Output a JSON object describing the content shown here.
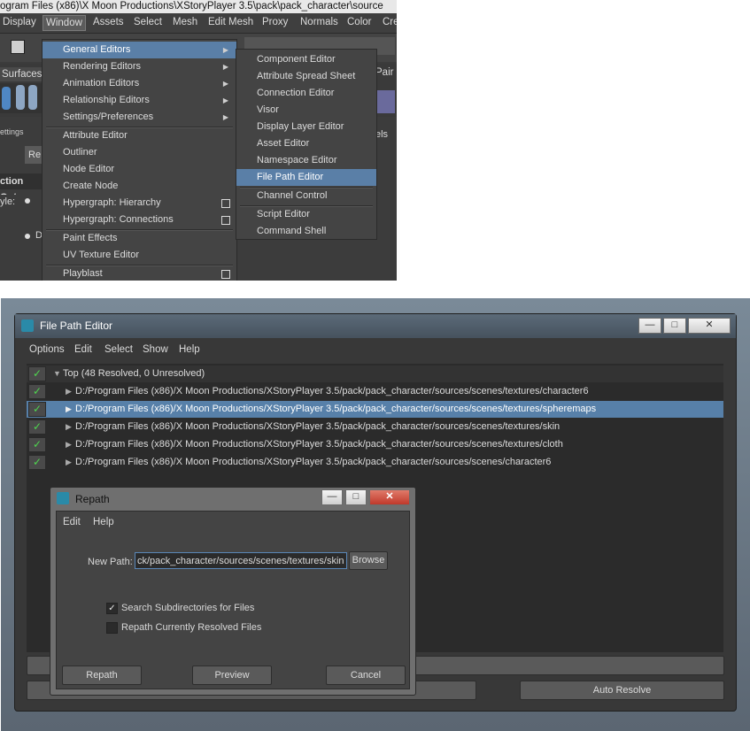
{
  "maya": {
    "title_path": "ogram Files (x86)\\X Moon Productions\\XStoryPlayer 3.5\\pack\\pack_character\\source",
    "menubar": [
      "Display",
      "Window",
      "Assets",
      "Select",
      "Mesh",
      "Edit Mesh",
      "Proxy",
      "Normals",
      "Color",
      "Cre"
    ],
    "shelf_label": "Surfaces",
    "shelf_right_label": "Pair",
    "left_labels": {
      "settings": "ettings",
      "re": "Re",
      "section": "ction Opt",
      "style": "yle:",
      "d": "D",
      "els": "els"
    },
    "window_menu": [
      {
        "label": "General Editors",
        "submenu": true,
        "highlighted": true
      },
      {
        "label": "Rendering Editors",
        "submenu": true
      },
      {
        "label": "Animation Editors",
        "submenu": true
      },
      {
        "label": "Relationship Editors",
        "submenu": true
      },
      {
        "label": "Settings/Preferences",
        "submenu": true
      },
      {
        "label": "Attribute Editor"
      },
      {
        "label": "Outliner"
      },
      {
        "label": "Node Editor"
      },
      {
        "label": "Create Node"
      },
      {
        "label": "Hypergraph: Hierarchy",
        "option_box": true
      },
      {
        "label": "Hypergraph: Connections",
        "option_box": true
      },
      {
        "label": "Paint Effects"
      },
      {
        "label": "UV Texture Editor"
      },
      {
        "label": "Playblast",
        "option_box": true
      }
    ],
    "general_editors_submenu": [
      {
        "label": "Component Editor"
      },
      {
        "label": "Attribute Spread Sheet"
      },
      {
        "label": "Connection Editor"
      },
      {
        "label": "Visor"
      },
      {
        "label": "Display Layer Editor"
      },
      {
        "label": "Asset Editor"
      },
      {
        "label": "Namespace Editor"
      },
      {
        "label": "File Path Editor",
        "highlighted": true
      },
      {
        "label": "Channel Control"
      },
      {
        "label": "Script Editor"
      },
      {
        "label": "Command Shell"
      }
    ]
  },
  "fpe": {
    "title": "File Path Editor",
    "menu": [
      "Options",
      "Edit",
      "Select",
      "Show",
      "Help"
    ],
    "top_row": "Top (48 Resolved, 0 Unresolved)",
    "paths": [
      {
        "path": "D:/Program Files (x86)/X Moon Productions/XStoryPlayer 3.5/pack/pack_character/sources/scenes/textures/character6",
        "selected": false
      },
      {
        "path": "D:/Program Files (x86)/X Moon Productions/XStoryPlayer 3.5/pack/pack_character/sources/scenes/textures/spheremaps",
        "selected": true
      },
      {
        "path": "D:/Program Files (x86)/X Moon Productions/XStoryPlayer 3.5/pack/pack_character/sources/scenes/textures/skin",
        "selected": false
      },
      {
        "path": "D:/Program Files (x86)/X Moon Productions/XStoryPlayer 3.5/pack/pack_character/sources/scenes/textures/cloth",
        "selected": false
      },
      {
        "path": "D:/Program Files (x86)/X Moon Productions/XStoryPlayer 3.5/pack/pack_character/sources/scenes/character6",
        "selected": false
      }
    ],
    "auto_resolve_label": "Auto Resolve"
  },
  "repath": {
    "title": "Repath",
    "menu": [
      "Edit",
      "Help"
    ],
    "new_path_label": "New Path:",
    "new_path_value": "ck/pack_character/sources/scenes/textures/skin",
    "browse_label": "Browse",
    "search_subdirs_label": "Search Subdirectories for Files",
    "search_subdirs_checked": true,
    "repath_resolved_label": "Repath Currently Resolved Files",
    "repath_resolved_checked": false,
    "repath_button": "Repath",
    "preview_button": "Preview",
    "cancel_button": "Cancel"
  },
  "window_controls": {
    "minimize": "—",
    "maximize": "□",
    "close": "✕"
  }
}
